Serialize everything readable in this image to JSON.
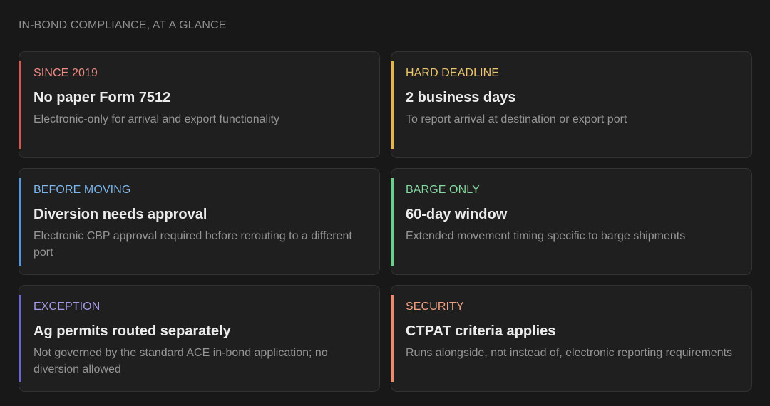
{
  "page": {
    "title": "IN-BOND COMPLIANCE, AT A GLANCE"
  },
  "cards": [
    {
      "tag": "SINCE 2019",
      "headline": "No paper Form 7512",
      "description": "Electronic-only for arrival and export functionality",
      "accent_color": "#d9564f",
      "tag_color": "#ec8a84"
    },
    {
      "tag": "HARD DEADLINE",
      "headline": "2 business days",
      "description": "To report arrival at destination or export port",
      "accent_color": "#e4b54f",
      "tag_color": "#ecc56f"
    },
    {
      "tag": "BEFORE MOVING",
      "headline": "Diversion needs approval",
      "description": "Electronic CBP approval required before rerouting to a different port",
      "accent_color": "#4f98e4",
      "tag_color": "#7cb6ea"
    },
    {
      "tag": "BARGE ONLY",
      "headline": "60-day window",
      "description": "Extended movement timing specific to barge shipments",
      "accent_color": "#6cd08d",
      "tag_color": "#86d6a0"
    },
    {
      "tag": "EXCEPTION",
      "headline": "Ag permits routed separately",
      "description": "Not governed by the standard ACE in-bond application; no diversion allowed",
      "accent_color": "#6e66d4",
      "tag_color": "#a49be7"
    },
    {
      "tag": "SECURITY",
      "headline": "CTPAT criteria applies",
      "description": "Runs alongside, not instead of, electronic reporting requirements",
      "accent_color": "#ec8c6c",
      "tag_color": "#efa283"
    }
  ]
}
